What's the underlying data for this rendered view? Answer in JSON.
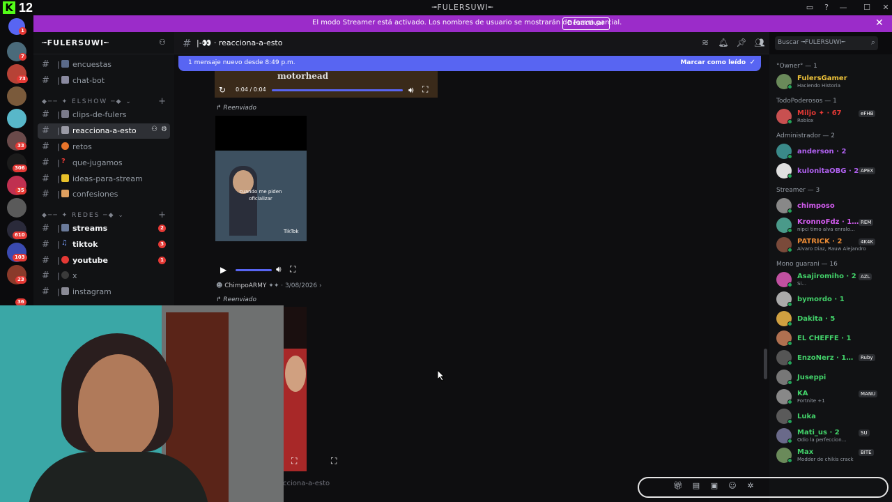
{
  "kick": {
    "logo": "K",
    "number": "12"
  },
  "window": {
    "title": "╼FULERSUWI╾",
    "buttons": [
      "—",
      "☐",
      "✕"
    ]
  },
  "banner": {
    "text": "El modo Streamer está activado. Los nombres de usuario se mostrarán de forma parcial.",
    "button": "Desactivar"
  },
  "rail": {
    "badges": [
      "1",
      "7",
      "73",
      "7",
      "33",
      "306",
      "35",
      "610",
      "103",
      "23",
      "36"
    ]
  },
  "server": {
    "name": "╼FULERSUWI╾"
  },
  "channels": {
    "top": [
      {
        "label": "encuestas"
      },
      {
        "label": "chat-bot"
      }
    ],
    "cat_show": "ELSHOW",
    "show": [
      {
        "label": "clips-de-fulers"
      },
      {
        "label": "reacciona-a-esto"
      },
      {
        "label": "retos"
      },
      {
        "label": "que-jugamos"
      },
      {
        "label": "ideas-para-stream"
      },
      {
        "label": "confesiones"
      }
    ],
    "cat_redes": "REDES",
    "redes": [
      {
        "label": "streams",
        "count": "2"
      },
      {
        "label": "tiktok",
        "count": "3"
      },
      {
        "label": "youtube",
        "count": "1"
      },
      {
        "label": "x"
      },
      {
        "label": "instagram"
      }
    ]
  },
  "header": {
    "channel": "reacciona-a-esto",
    "search_placeholder": "Buscar ╼FULERSUWI╾"
  },
  "chat": {
    "new_messages": "1 mensaje nuevo desde 8:49 p.m.",
    "mark_read": "Marcar como leído",
    "audio_time": "0:04 / 0:04",
    "forwarded": "Reenviado",
    "video_caption": "cuando me piden oficializar",
    "meta_user": "ChimpoARMY",
    "meta_date": "3/08/2026",
    "composer_placeholder": "cciona-a-esto",
    "tiktok": "TikTok",
    "colors": {
      "accent": "#5865f2",
      "banner": "#9b2cc9"
    }
  },
  "members": {
    "groups": [
      {
        "label": "°Owner° — 1",
        "items": [
          {
            "name": "FulersGamer",
            "status": "Haciendo Historia",
            "color": "#f0c43a"
          }
        ]
      },
      {
        "label": "TodoPoderosos — 1",
        "items": [
          {
            "name": "Miljo ✦ · 67",
            "status": "Roblox",
            "color": "#e53935",
            "tag": "eFHB"
          }
        ]
      },
      {
        "label": "Administrador — 2",
        "items": [
          {
            "name": "anderson · 2",
            "color": "#b061f0"
          },
          {
            "name": "kulonitaOBG · 2…",
            "color": "#b061f0",
            "tag": "APEX"
          }
        ]
      },
      {
        "label": "Streamer — 3",
        "items": [
          {
            "name": "chimposo",
            "color": "#d35cf0"
          },
          {
            "name": "KronnoFdz · 1…",
            "status": "nipci timo alva enralo…",
            "color": "#d35cf0",
            "tag": "REM"
          },
          {
            "name": "PATRICK · 2",
            "status": "Alvaro Diaz, Rauw Alejandro",
            "color": "#e98a35",
            "tag": "4K4K"
          }
        ]
      },
      {
        "label": "Mono guarani — 16",
        "items": [
          {
            "name": "Asajiromiho · 2",
            "status": "Si...",
            "color": "#43d36a",
            "tag": "AZL"
          },
          {
            "name": "bymordo · 1",
            "color": "#43d36a"
          },
          {
            "name": "Dakita · 5",
            "color": "#43d36a"
          },
          {
            "name": "EL CHEFFE · 1",
            "color": "#43d36a"
          },
          {
            "name": "EnzoNerz · 1…",
            "color": "#43d36a",
            "tag": "Ruby"
          },
          {
            "name": "Juseppi",
            "color": "#43d36a"
          },
          {
            "name": "KA",
            "status": "Fortnite +1",
            "color": "#43d36a",
            "tag": "MANU"
          },
          {
            "name": "Luka",
            "color": "#43d36a"
          },
          {
            "name": "Mati_us · 2",
            "status": "Odio la perfeccion…",
            "color": "#43d36a",
            "tag": "SU"
          },
          {
            "name": "Max",
            "status": "Modder de chikis crack",
            "color": "#43d36a",
            "tag": "BITE"
          }
        ]
      }
    ]
  }
}
